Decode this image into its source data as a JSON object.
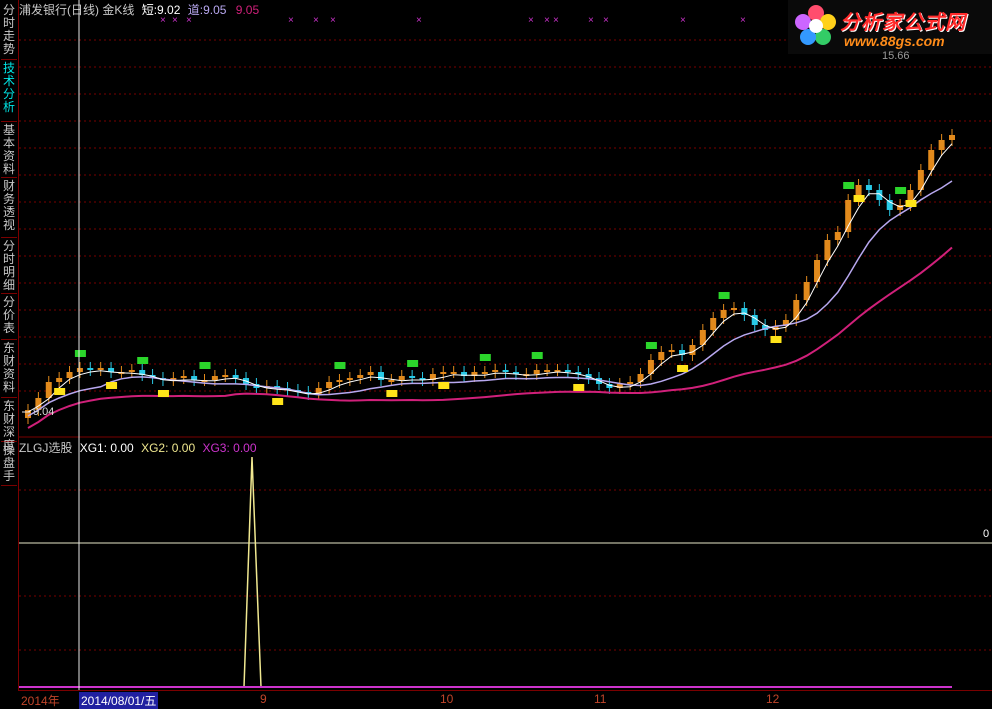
{
  "sidebar": {
    "tabs": [
      {
        "label": "分时走势",
        "active": false
      },
      {
        "label": "技术分析",
        "active": true
      },
      {
        "label": "基本资料",
        "active": false
      },
      {
        "label": "财务透视",
        "active": false
      },
      {
        "label": "分时明细",
        "active": false
      },
      {
        "label": "分价表",
        "active": false
      },
      {
        "label": "东财资料",
        "active": false
      },
      {
        "label": "东财深度",
        "active": false
      },
      {
        "label": "操盘手",
        "active": false
      }
    ]
  },
  "main_panel": {
    "legend": {
      "title": "浦发银行(日线) 金K线",
      "short_label": "短:",
      "short_value": "9.02",
      "dao_label": "道:",
      "dao_value": "9.05",
      "third_value": "9.05"
    },
    "price_labels": {
      "low": "9.04",
      "high": "15.66"
    }
  },
  "sub_panel": {
    "legend": {
      "title": "ZLGJ选股",
      "xg1": "XG1: 0.00",
      "xg2": "XG2: 0.00",
      "xg3": "XG3: 0.00"
    },
    "right_value": "0"
  },
  "time_axis": {
    "year_label": "2014年",
    "cursor_date": "2014/08/01/五",
    "month_labels": [
      "9",
      "10",
      "11",
      "12"
    ]
  },
  "logo": {
    "title": "分析家公式网",
    "url": "www.88gs.com"
  },
  "colors": {
    "up_candle": "#e28a1c",
    "down_candle": "#29c9e6",
    "long_ma": "#d0207a",
    "short_ma": "#ffffff",
    "mid_ma": "#b8a8f0",
    "buy_marker": "#ffe419",
    "sell_marker": "#2bd62b",
    "grid": "#7a0000",
    "signal_line": "#f0e890",
    "magenta_marker": "#cc33cc"
  }
}
